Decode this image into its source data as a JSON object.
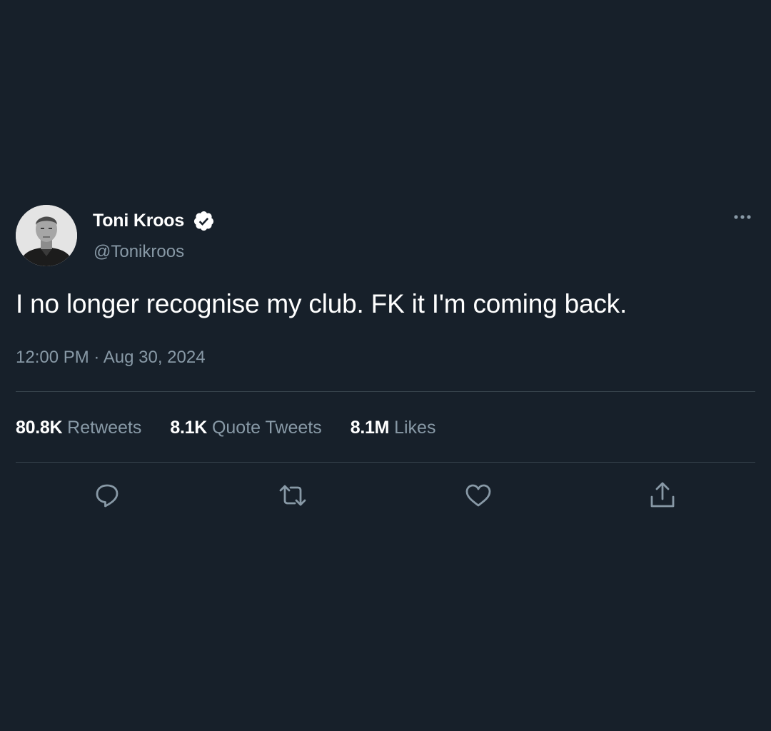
{
  "tweet": {
    "author": {
      "display_name": "Toni Kroos",
      "handle": "@Tonikroos",
      "verified": true
    },
    "text": "I no longer recognise my club. FK it I'm coming back.",
    "time": "12:00 PM",
    "separator": " · ",
    "date": "Aug 30, 2024",
    "stats": {
      "retweets": {
        "count": "80.8K",
        "label": " Retweets"
      },
      "quote_tweets": {
        "count": "8.1K",
        "label": " Quote Tweets"
      },
      "likes": {
        "count": "8.1M",
        "label": " Likes"
      }
    },
    "actions": {
      "reply_icon": "reply-icon",
      "retweet_icon": "retweet-icon",
      "like_icon": "heart-icon",
      "share_icon": "share-icon"
    }
  },
  "colors": {
    "background": "#17202a",
    "primary_text": "#ffffff",
    "secondary_text": "#8899a6",
    "divider": "#38444d"
  }
}
